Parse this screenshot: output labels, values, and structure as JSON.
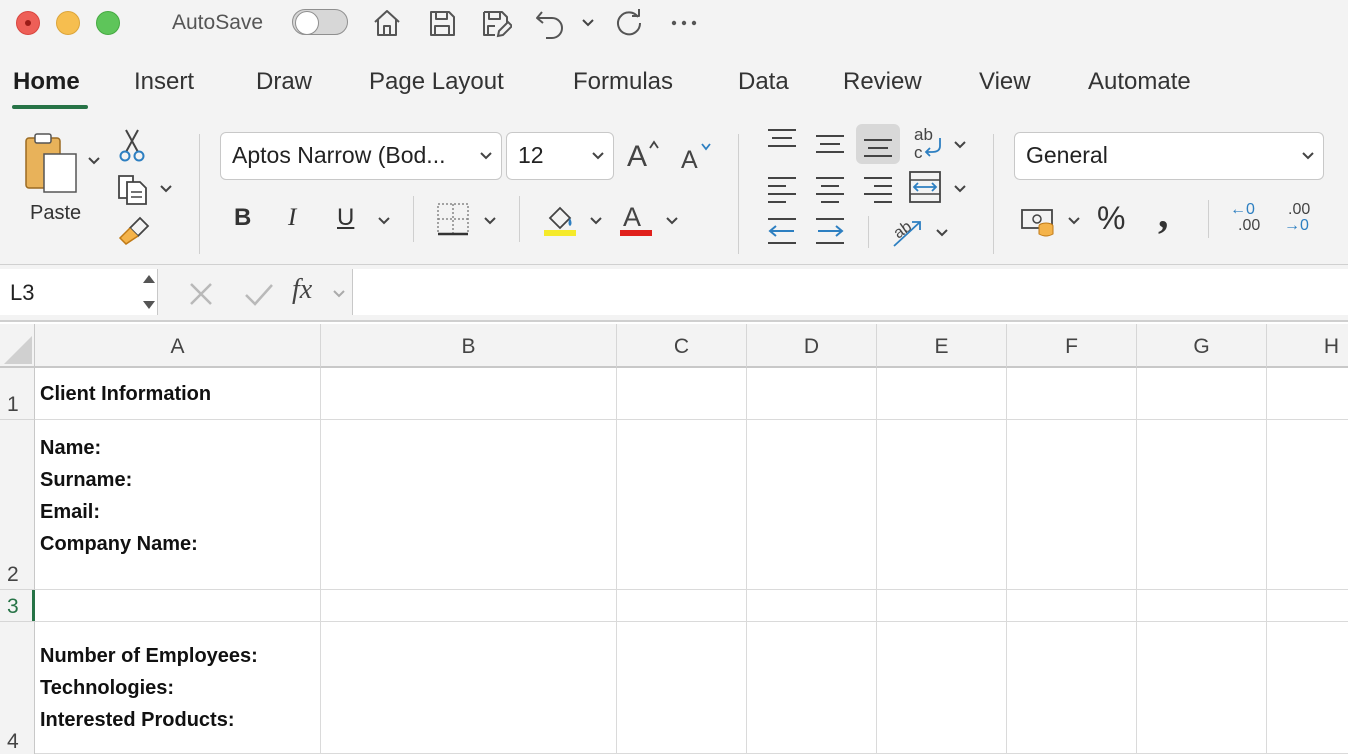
{
  "titlebar": {
    "autosave_label": "AutoSave",
    "autosave_on": false
  },
  "tabs": [
    "Home",
    "Insert",
    "Draw",
    "Page Layout",
    "Formulas",
    "Data",
    "Review",
    "View",
    "Automate"
  ],
  "active_tab": "Home",
  "ribbon": {
    "paste_label": "Paste",
    "font_name": "Aptos Narrow (Bod...",
    "font_size": "12",
    "bold": "B",
    "italic": "I",
    "underline": "U",
    "font_color_glyph": "A",
    "number_format": "General",
    "percent": "%",
    "comma": ",",
    "increase_decimal_top": "←0",
    "increase_decimal_bottom": ".00",
    "decrease_decimal_top": ".00",
    "decrease_decimal_bottom": "→0",
    "highlight_color": "#f5ea2a",
    "font_color": "#e0201c"
  },
  "formula_bar": {
    "name_box": "L3",
    "fx_label": "fx",
    "formula": ""
  },
  "grid": {
    "columns": [
      "A",
      "B",
      "C",
      "D",
      "E",
      "F",
      "G",
      "H"
    ],
    "rows": [
      "1",
      "2",
      "3",
      "4"
    ],
    "selected_row": "3",
    "cells": {
      "A1": "Client Information",
      "A2": [
        "Name:",
        "Surname:",
        "Email:",
        "Company Name:"
      ],
      "A4": [
        "Number of Employees:",
        "Technologies:",
        "Interested Products:"
      ]
    }
  },
  "colors": {
    "accent": "#267346",
    "close": "#ee5f57",
    "minimize": "#f6be4f",
    "zoom": "#5ec55a"
  }
}
